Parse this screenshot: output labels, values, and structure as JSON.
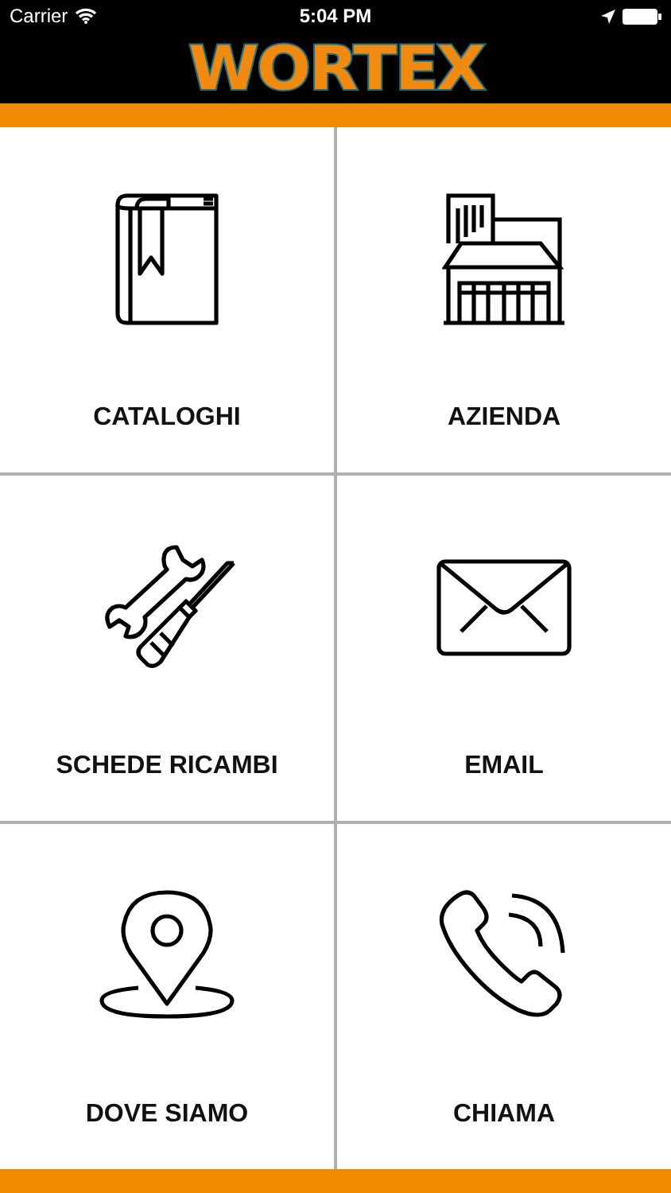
{
  "status_bar": {
    "carrier": "Carrier",
    "time": "5:04 PM"
  },
  "header": {
    "logo": "WORTEX"
  },
  "tiles": [
    {
      "label": "CATALOGHI"
    },
    {
      "label": "AZIENDA"
    },
    {
      "label": "SCHEDE RICAMBI"
    },
    {
      "label": "EMAIL"
    },
    {
      "label": "DOVE SIAMO"
    },
    {
      "label": "CHIAMA"
    }
  ]
}
